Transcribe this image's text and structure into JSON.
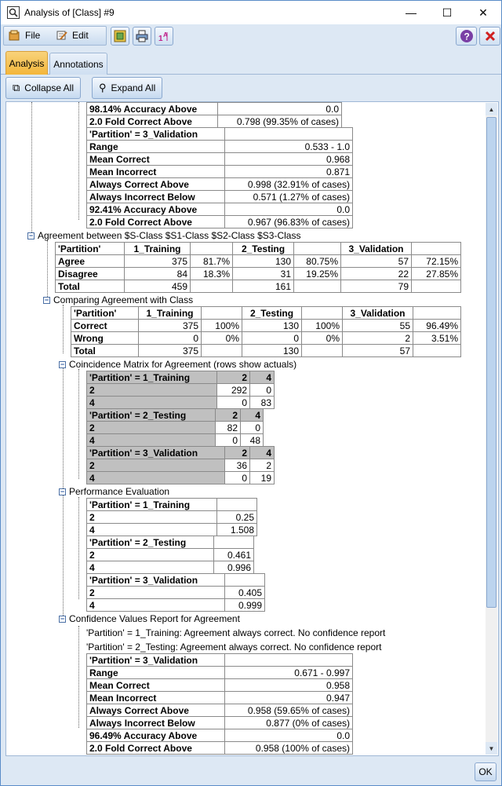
{
  "window": {
    "title": "Analysis of [Class] #9",
    "minimize": "—",
    "maximize": "☐",
    "close": "✕"
  },
  "menu": {
    "file": "File",
    "edit": "Edit"
  },
  "tabs": [
    {
      "label": "Analysis"
    },
    {
      "label": "Annotations"
    }
  ],
  "actions": {
    "collapse": "Collapse All",
    "expand": "Expand All"
  },
  "ok": "OK",
  "topTable": {
    "rows": [
      [
        "98.14% Accuracy Above",
        "0.0"
      ],
      [
        "2.0 Fold Correct Above",
        "0.798 (99.35% of cases)"
      ]
    ]
  },
  "valTable": {
    "header": "'Partition' = 3_Validation",
    "rows": [
      [
        "Range",
        "0.533 - 1.0"
      ],
      [
        "Mean Correct",
        "0.968"
      ],
      [
        "Mean Incorrect",
        "0.871"
      ],
      [
        "Always Correct Above",
        "0.998 (32.91% of cases)"
      ],
      [
        "Always Incorrect Below",
        "0.571 (1.27% of cases)"
      ],
      [
        "92.41% Accuracy Above",
        "0.0"
      ],
      [
        "2.0 Fold Correct Above",
        "0.967 (96.83% of cases)"
      ]
    ]
  },
  "agreement": {
    "title": "Agreement between  $S-Class $S1-Class $S2-Class $S3-Class",
    "header": [
      "'Partition'",
      "1_Training",
      "",
      "2_Testing",
      "",
      "3_Validation",
      ""
    ],
    "rows": [
      [
        "Agree",
        "375",
        "81.7%",
        "130",
        "80.75%",
        "57",
        "72.15%"
      ],
      [
        "Disagree",
        "84",
        "18.3%",
        "31",
        "19.25%",
        "22",
        "27.85%"
      ],
      [
        "Total",
        "459",
        "",
        "161",
        "",
        "79",
        ""
      ]
    ]
  },
  "compare": {
    "title": "Comparing Agreement with Class",
    "header": [
      "'Partition'",
      "1_Training",
      "",
      "2_Testing",
      "",
      "3_Validation",
      ""
    ],
    "rows": [
      [
        "Correct",
        "375",
        "100%",
        "130",
        "100%",
        "55",
        "96.49%"
      ],
      [
        "Wrong",
        "0",
        "0%",
        "0",
        "0%",
        "2",
        "3.51%"
      ],
      [
        "Total",
        "375",
        "",
        "130",
        "",
        "57",
        ""
      ]
    ]
  },
  "coincidence": {
    "title": "Coincidence Matrix for Agreement (rows show actuals)",
    "blocks": [
      {
        "header": "'Partition' = 1_Training",
        "cols": [
          "2",
          "4"
        ],
        "rows": [
          [
            "2",
            "292",
            "0"
          ],
          [
            "4",
            "0",
            "83"
          ]
        ]
      },
      {
        "header": "'Partition' = 2_Testing",
        "cols": [
          "2",
          "4"
        ],
        "rows": [
          [
            "2",
            "82",
            "0"
          ],
          [
            "4",
            "0",
            "48"
          ]
        ]
      },
      {
        "header": "'Partition' = 3_Validation",
        "cols": [
          "2",
          "4"
        ],
        "rows": [
          [
            "2",
            "36",
            "2"
          ],
          [
            "4",
            "0",
            "19"
          ]
        ]
      }
    ]
  },
  "performance": {
    "title": "Performance Evaluation",
    "blocks": [
      {
        "header": "'Partition' = 1_Training",
        "rows": [
          [
            "2",
            "0.25"
          ],
          [
            "4",
            "1.508"
          ]
        ]
      },
      {
        "header": "'Partition' = 2_Testing",
        "rows": [
          [
            "2",
            "0.461"
          ],
          [
            "4",
            "0.996"
          ]
        ]
      },
      {
        "header": "'Partition' = 3_Validation",
        "rows": [
          [
            "2",
            "0.405"
          ],
          [
            "4",
            "0.999"
          ]
        ]
      }
    ]
  },
  "confidence": {
    "title": "Confidence Values Report for Agreement",
    "note1": "'Partition' = 1_Training: Agreement always correct. No confidence report",
    "note2": "'Partition' = 2_Testing: Agreement always correct. No confidence report",
    "header": "'Partition' = 3_Validation",
    "rows": [
      [
        "Range",
        "0.671 - 0.997"
      ],
      [
        "Mean Correct",
        "0.958"
      ],
      [
        "Mean Incorrect",
        "0.947"
      ],
      [
        "Always Correct Above",
        "0.958 (59.65% of cases)"
      ],
      [
        "Always Incorrect Below",
        "0.877 (0% of cases)"
      ],
      [
        "96.49% Accuracy Above",
        "0.0"
      ],
      [
        "2.0 Fold Correct Above",
        "0.958 (100% of cases)"
      ]
    ]
  }
}
